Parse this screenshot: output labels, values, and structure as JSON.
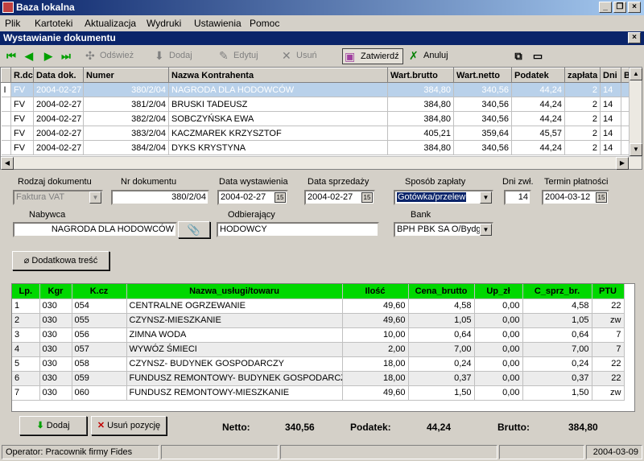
{
  "window": {
    "title": "Baza lokalna",
    "minimize": "_",
    "restore": "❐",
    "close": "×"
  },
  "menu": [
    "Plik",
    "Kartoteki",
    "Aktualizacja",
    "Wydruki",
    "Ustawienia",
    "Pomoc"
  ],
  "subwindow": {
    "title": "Wystawianie dokumentu",
    "close": "×"
  },
  "toolbar": {
    "refresh": "Odśwież",
    "add": "Dodaj",
    "edit": "Edytuj",
    "delete": "Usuń",
    "confirm": "Zatwierdź",
    "cancel": "Anuluj"
  },
  "grid": {
    "columns": [
      "R.dc",
      "Data dok.",
      "Numer",
      "Nazwa Kontrahenta",
      "Wart.brutto",
      "Wart.netto",
      "Podatek",
      "zapłata",
      "Dni",
      "B"
    ],
    "rows": [
      [
        "FV",
        "2004-02-27",
        "380/2/04",
        "NAGRODA DLA HODOWCÓW",
        "384,80",
        "340,56",
        "44,24",
        "2",
        "14"
      ],
      [
        "FV",
        "2004-02-27",
        "381/2/04",
        "BRUSKI TADEUSZ",
        "384,80",
        "340,56",
        "44,24",
        "2",
        "14"
      ],
      [
        "FV",
        "2004-02-27",
        "382/2/04",
        "SOBCZYŃSKA EWA",
        "384,80",
        "340,56",
        "44,24",
        "2",
        "14"
      ],
      [
        "FV",
        "2004-02-27",
        "383/2/04",
        "KACZMAREK KRZYSZTOF",
        "405,21",
        "359,64",
        "45,57",
        "2",
        "14"
      ],
      [
        "FV",
        "2004-02-27",
        "384/2/04",
        "DYKS KRYSTYNA",
        "384,80",
        "340,56",
        "44,24",
        "2",
        "14"
      ]
    ]
  },
  "form": {
    "doc_type_label": "Rodzaj dokumentu",
    "doc_type": "Faktura VAT",
    "doc_no_label": "Nr dokumentu",
    "doc_no": "380/2/04",
    "issue_date_label": "Data wystawienia",
    "issue_date": "2004-02-27",
    "sale_date_label": "Data sprzedaży",
    "sale_date": "2004-02-27",
    "payment_label": "Sposób zapłaty",
    "payment": "Gotówka/przelew",
    "days_label": "Dni zwł.",
    "days": "14",
    "due_label": "Termin płatności",
    "due_date": "2004-03-12",
    "buyer_label": "Nabywca",
    "buyer": "NAGRODA DLA HODOWCÓW",
    "receiver_label": "Odbierający",
    "receiver": "HODOWCY",
    "bank_label": "Bank",
    "bank": "BPH PBK SA O/Bydg",
    "extra_button": "Dodatkowa treść"
  },
  "items": {
    "columns": [
      "Lp.",
      "Kgr",
      "K.cz",
      "Nazwa_usługi/towaru",
      "Ilość",
      "Cena_brutto",
      "Up_zł",
      "C_sprz_br.",
      "PTU"
    ],
    "rows": [
      [
        "1",
        "030",
        "054",
        "CENTRALNE OGRZEWANIE",
        "49,60",
        "4,58",
        "0,00",
        "4,58",
        "22"
      ],
      [
        "2",
        "030",
        "055",
        "CZYNSZ-MIESZKANIE",
        "49,60",
        "1,05",
        "0,00",
        "1,05",
        "zw"
      ],
      [
        "3",
        "030",
        "056",
        "ZIMNA WODA",
        "10,00",
        "0,64",
        "0,00",
        "0,64",
        "7"
      ],
      [
        "4",
        "030",
        "057",
        "WYWÓZ ŚMIECI",
        "2,00",
        "7,00",
        "0,00",
        "7,00",
        "7"
      ],
      [
        "5",
        "030",
        "058",
        "CZYNSZ- BUDYNEK GOSPODARCZY",
        "18,00",
        "0,24",
        "0,00",
        "0,24",
        "22"
      ],
      [
        "6",
        "030",
        "059",
        "FUNDUSZ REMONTOWY- BUDYNEK  GOSPODARCZY",
        "18,00",
        "0,37",
        "0,00",
        "0,37",
        "22"
      ],
      [
        "7",
        "030",
        "060",
        "FUNDUSZ REMONTOWY-MIESZKANIE",
        "49,60",
        "1,50",
        "0,00",
        "1,50",
        "zw"
      ]
    ]
  },
  "bottom": {
    "add": "Dodaj",
    "remove": "Usuń pozycję",
    "netto_label": "Netto:",
    "netto": "340,56",
    "tax_label": "Podatek:",
    "tax": "44,24",
    "brutto_label": "Brutto:",
    "brutto": "384,80"
  },
  "status": {
    "operator": "Operator: Pracownik firmy Fides",
    "date": "2004-03-09"
  }
}
